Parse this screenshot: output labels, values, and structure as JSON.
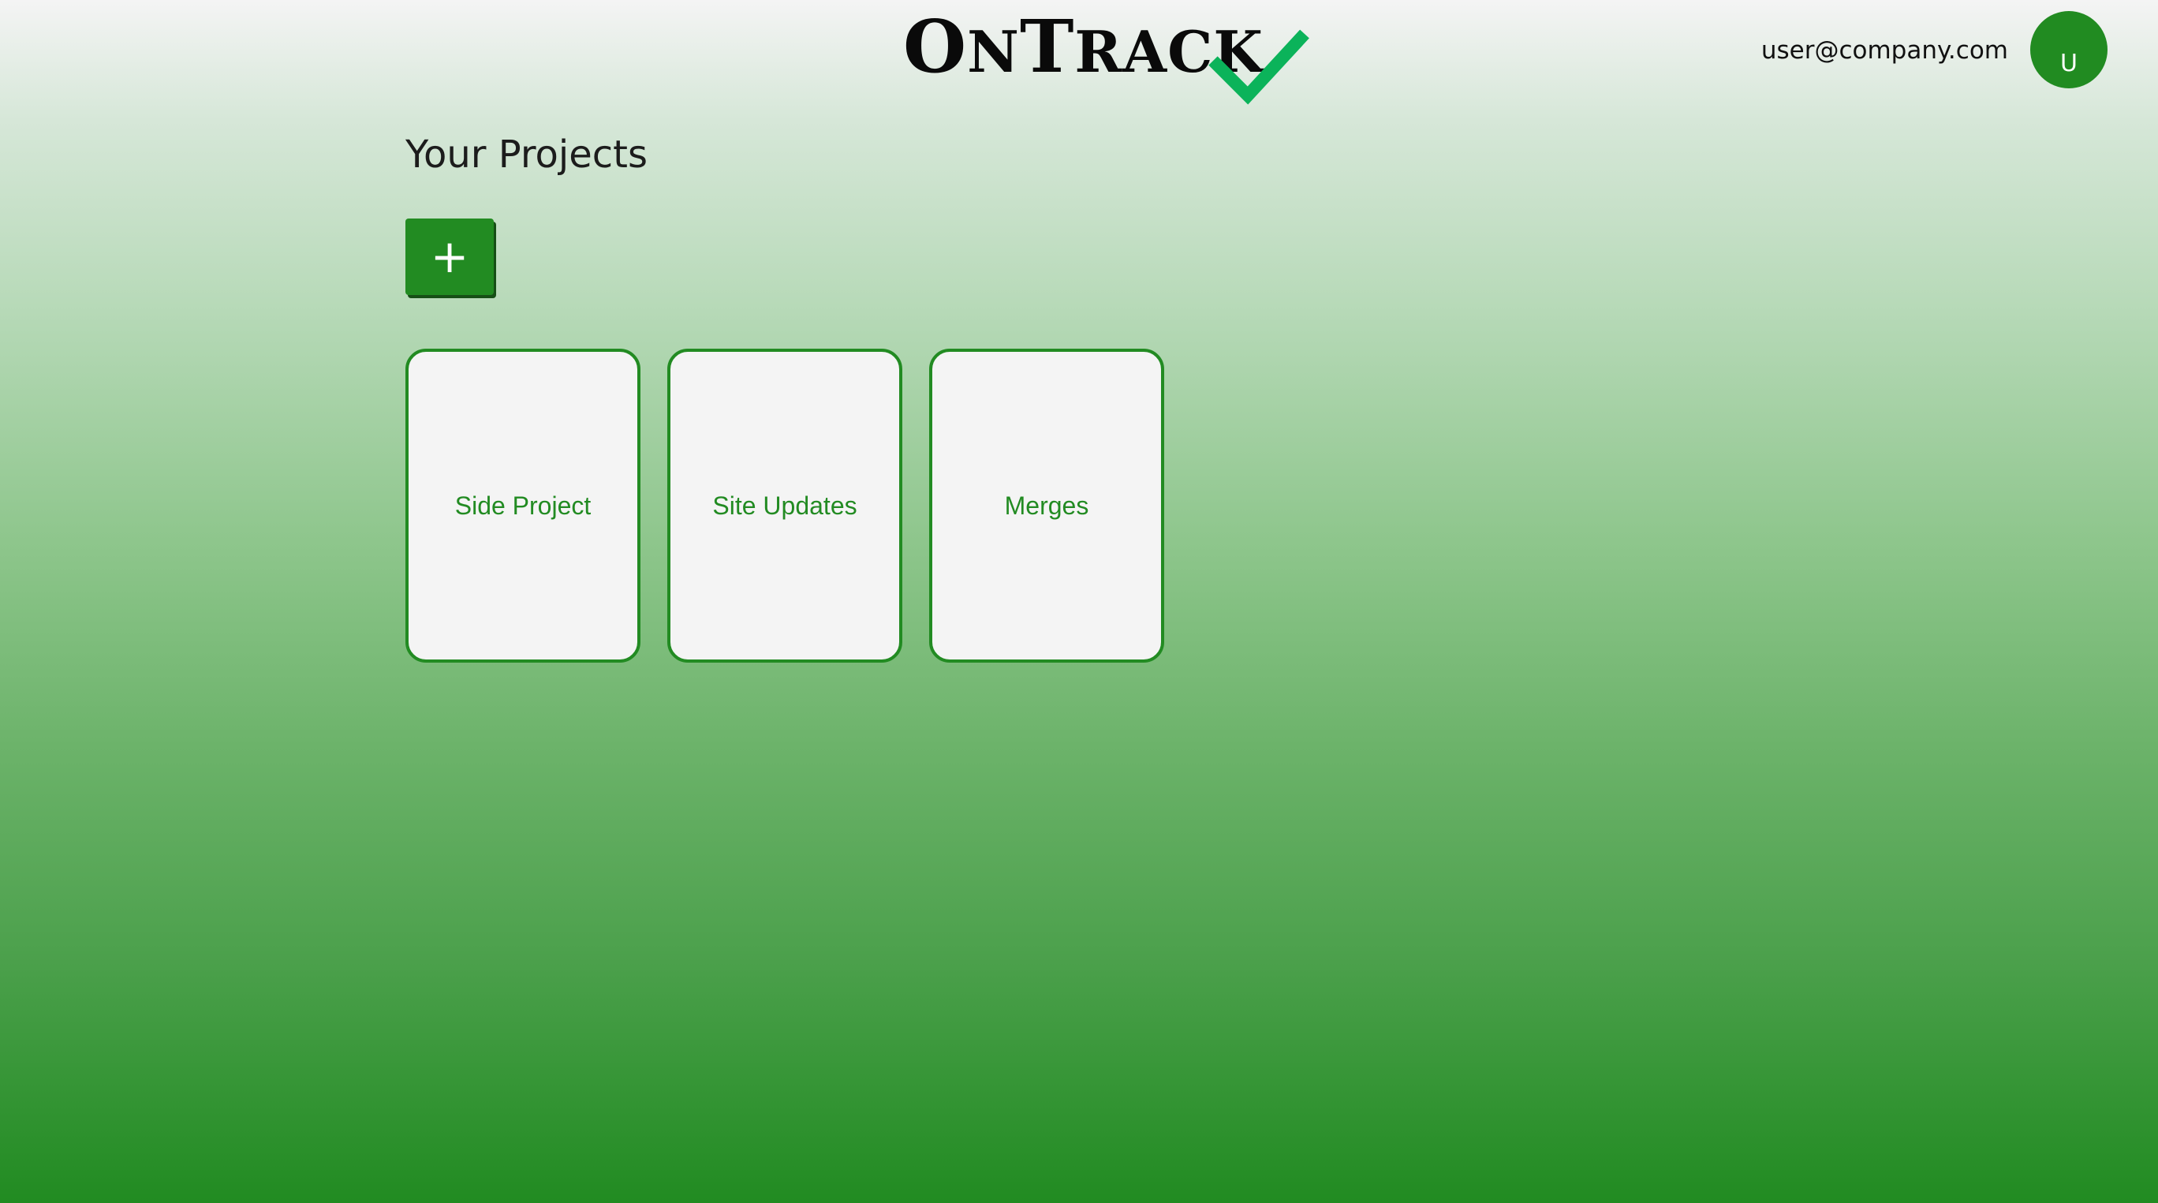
{
  "header": {
    "logo": {
      "text": "OnTrack",
      "check_icon": "checkmark-icon",
      "check_color": "#0bb35a"
    },
    "user_email": "user@company.com",
    "avatar_initial": "U"
  },
  "main": {
    "title": "Your Projects",
    "add_button_label": "+",
    "projects": [
      {
        "name": "Side Project"
      },
      {
        "name": "Site Updates"
      },
      {
        "name": "Merges"
      }
    ]
  },
  "colors": {
    "accent": "#228b22",
    "card_background": "#f4f4f4"
  }
}
